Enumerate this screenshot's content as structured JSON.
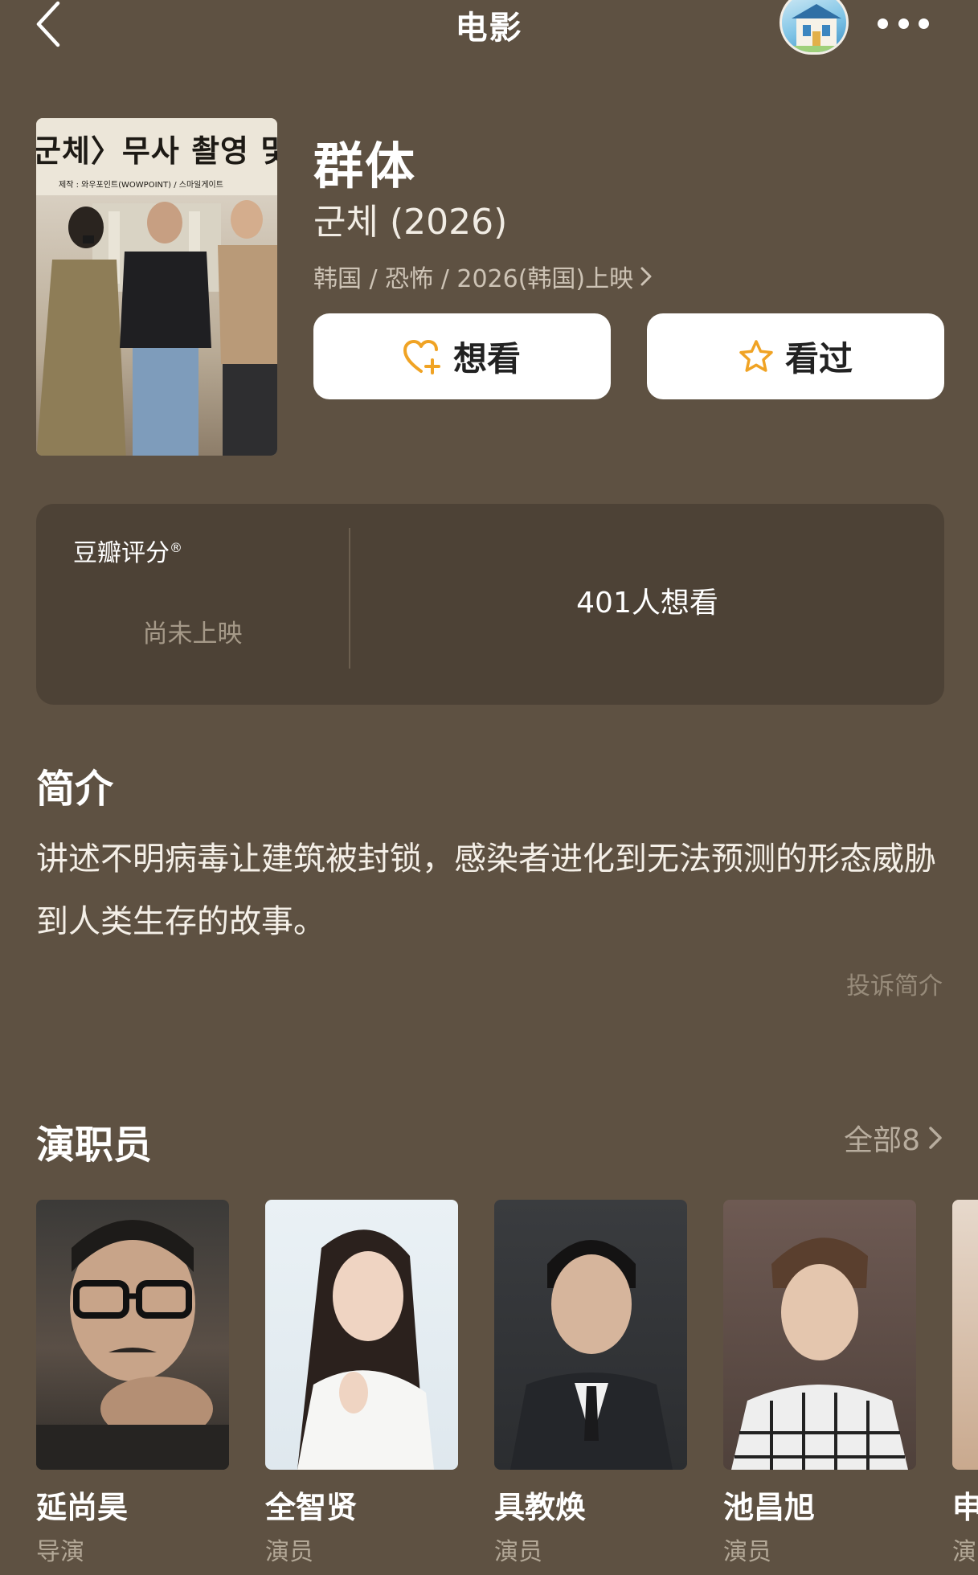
{
  "nav": {
    "title": "电影"
  },
  "movie": {
    "title_zh": "群体",
    "title_original": "군체 (2026)",
    "meta": "韩国 / 恐怖 / 2026(韩国)上映",
    "poster_text_main": "군체〉무사 촬영 및 대박",
    "poster_text_sub": "제작 : 와우포인트(WOWPOINT) / 스마일게이트"
  },
  "actions": {
    "want_label": "想看",
    "seen_label": "看过"
  },
  "rating": {
    "label": "豆瓣评分",
    "registered_mark": "®",
    "status": "尚未上映",
    "want_count": "401人想看"
  },
  "synopsis": {
    "title": "简介",
    "text": "讲述不明病毒让建筑被封锁，感染者进化到无法预测的形态威胁到人类生存的故事。",
    "report": "投诉简介"
  },
  "cast": {
    "title": "演职员",
    "all_label": "全部8",
    "members": [
      {
        "name": "延尚昊",
        "role": "导演"
      },
      {
        "name": "全智贤",
        "role": "演员"
      },
      {
        "name": "具教焕",
        "role": "演员"
      },
      {
        "name": "池昌旭",
        "role": "演员"
      },
      {
        "name": "申",
        "role": "演"
      }
    ]
  },
  "colors": {
    "background": "#5e5142",
    "card": "#4d4236",
    "button": "#ffffff",
    "accent": "#f0a324"
  }
}
